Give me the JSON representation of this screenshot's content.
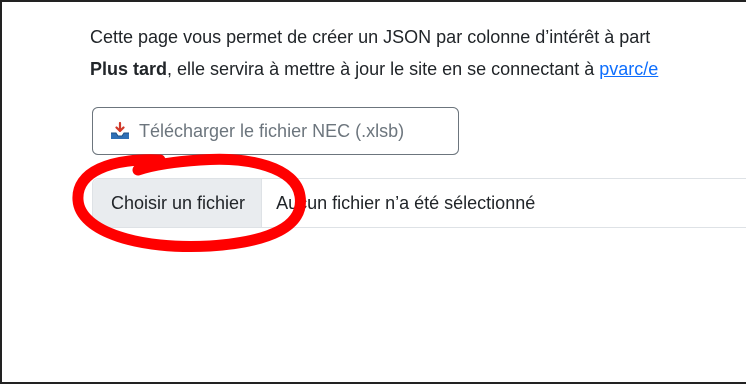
{
  "intro": {
    "line1": "Cette page vous permet de créer un JSON par colonne d’intérêt à part",
    "line2_bold": "Plus tard",
    "line2_rest": ", elle servira à mettre à jour le site en se connectant à ",
    "line2_link": "pvarc/e"
  },
  "download_button": {
    "label": "Télécharger le fichier NEC (.xlsb)",
    "icon": "download-tray-icon"
  },
  "file_input": {
    "button_label": "Choisir un fichier",
    "status": "Aucun fichier n’a été sélectionné"
  },
  "colors": {
    "link": "#0d6efd",
    "annotation": "#ff0000",
    "secondary": "#6c757d",
    "file_button_bg": "#e9ecef"
  }
}
